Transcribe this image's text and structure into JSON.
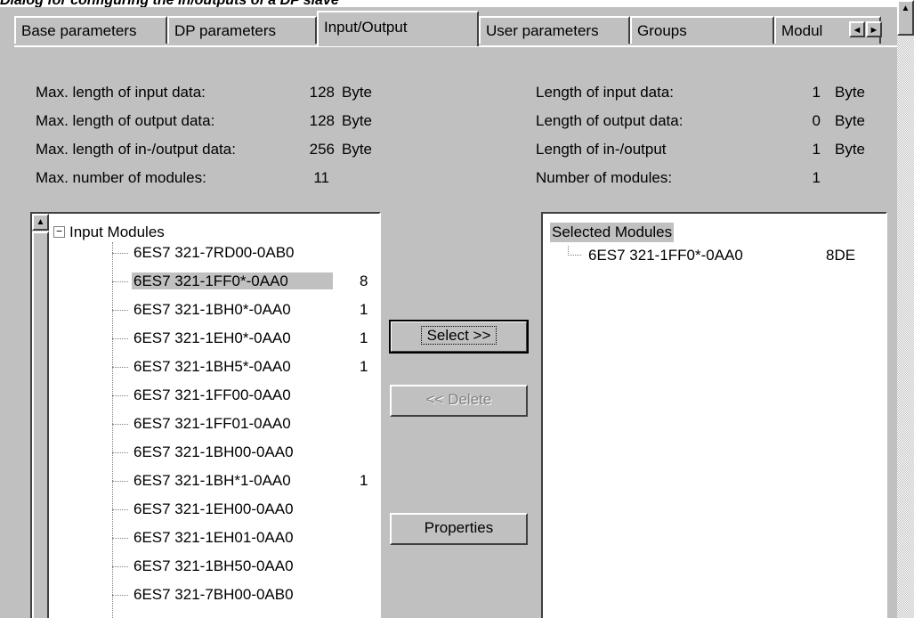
{
  "caption": "Dialog for configuring the in/outputs of a DP slave",
  "tabs": [
    {
      "label": "Base parameters"
    },
    {
      "label": "DP parameters"
    },
    {
      "label": "Input/Output"
    },
    {
      "label": "User parameters"
    },
    {
      "label": "Groups"
    },
    {
      "label": "Modul"
    }
  ],
  "active_tab": "Input/Output",
  "left_params": [
    {
      "label": "Max. length of input data:",
      "value": "128",
      "unit": "Byte"
    },
    {
      "label": "Max. length of output data:",
      "value": "128",
      "unit": "Byte"
    },
    {
      "label": "Max. length of in-/output data:",
      "value": "256",
      "unit": "Byte"
    },
    {
      "label": "Max. number of modules:",
      "value": "11",
      "unit": ""
    }
  ],
  "right_params": [
    {
      "label": "Length of input data:",
      "value": "1",
      "unit": "Byte"
    },
    {
      "label": "Length of output data:",
      "value": "0",
      "unit": "Byte"
    },
    {
      "label": "Length of in-/output",
      "value": "1",
      "unit": "Byte"
    },
    {
      "label": "Number of modules:",
      "value": "1",
      "unit": ""
    }
  ],
  "module_tree": {
    "root_label": "Input Modules",
    "expander": "−",
    "items": [
      {
        "label": "6ES7 321-7RD00-0AB0",
        "code": ""
      },
      {
        "label": "6ES7 321-1FF0*-0AA0",
        "code": "8"
      },
      {
        "label": "6ES7 321-1BH0*-0AA0",
        "code": "1"
      },
      {
        "label": "6ES7 321-1EH0*-0AA0",
        "code": "1"
      },
      {
        "label": "6ES7 321-1BH5*-0AA0",
        "code": "1"
      },
      {
        "label": "6ES7 321-1FF00-0AA0",
        "code": ""
      },
      {
        "label": "6ES7 321-1FF01-0AA0",
        "code": ""
      },
      {
        "label": "6ES7 321-1BH00-0AA0",
        "code": ""
      },
      {
        "label": "6ES7 321-1BH*1-0AA0",
        "code": "1"
      },
      {
        "label": "6ES7 321-1EH00-0AA0",
        "code": ""
      },
      {
        "label": "6ES7 321-1EH01-0AA0",
        "code": ""
      },
      {
        "label": "6ES7 321-1BH50-0AA0",
        "code": ""
      },
      {
        "label": "6ES7 321-7BH00-0AB0",
        "code": ""
      }
    ]
  },
  "buttons": {
    "select": "Select >>",
    "delete": "<< Delete",
    "properties": "Properties"
  },
  "selected_modules": {
    "title": "Selected Modules",
    "items": [
      {
        "label": "6ES7 321-1FF0*-0AA0",
        "code": "8DE"
      }
    ]
  },
  "icons": {
    "tab_left": "◄",
    "tab_right": "►",
    "scroll_up": "▲"
  }
}
